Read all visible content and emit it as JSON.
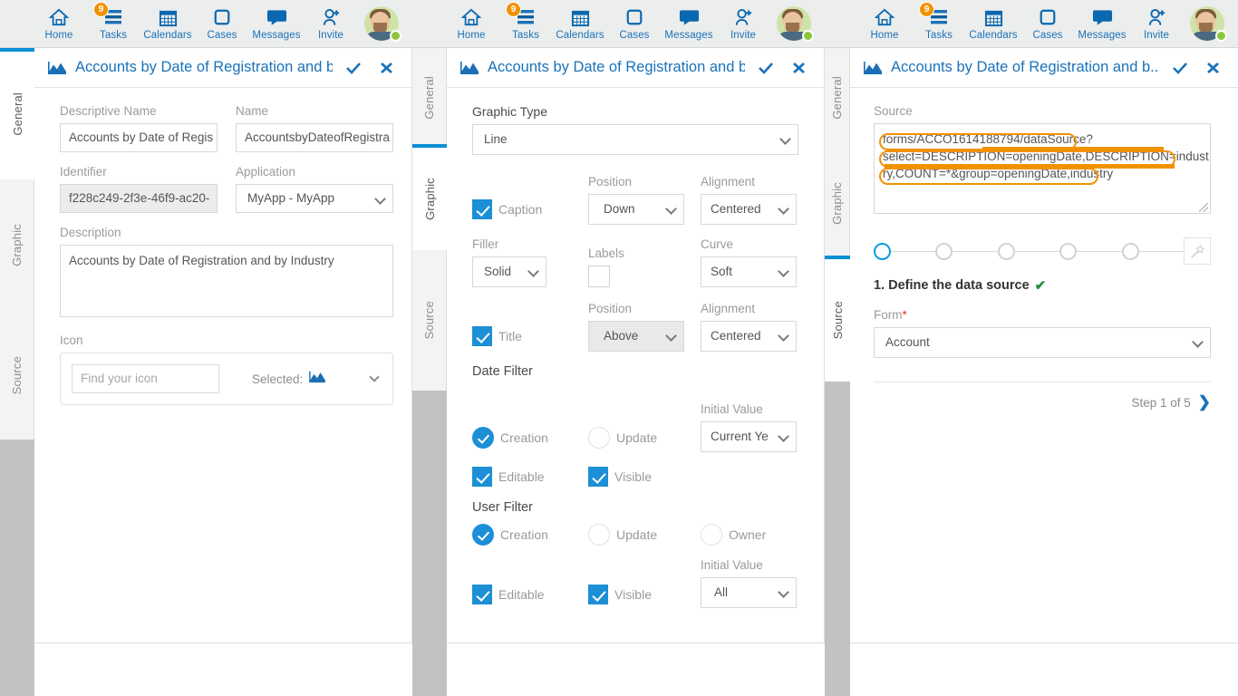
{
  "nav": {
    "items": [
      {
        "label": "Home",
        "icon": "home-icon",
        "badge": null
      },
      {
        "label": "Tasks",
        "icon": "tasks-icon",
        "badge": "9"
      },
      {
        "label": "Calendars",
        "icon": "calendar-icon",
        "badge": null
      },
      {
        "label": "Cases",
        "icon": "cases-icon",
        "badge": null
      },
      {
        "label": "Messages",
        "icon": "messages-icon",
        "badge": null
      },
      {
        "label": "Invite",
        "icon": "invite-user-icon",
        "badge": null
      }
    ]
  },
  "window": {
    "title": "Accounts by Date of Registration and b...",
    "accept_label": "✔",
    "close_label": "✖"
  },
  "vtabs": [
    "General",
    "Graphic",
    "Source"
  ],
  "panel1": {
    "active_tab": "General",
    "descriptive_name": {
      "label": "Descriptive Name",
      "value": "Accounts by Date of Regis"
    },
    "name": {
      "label": "Name",
      "value": "AccountsbyDateofRegistra"
    },
    "identifier": {
      "label": "Identifier",
      "value": "f228c249-2f3e-46f9-ac20-"
    },
    "application": {
      "label": "Application",
      "value": "MyApp - MyApp"
    },
    "description": {
      "label": "Description",
      "value": "Accounts by Date of Registration and by Industry"
    },
    "icon": {
      "label": "Icon",
      "search_placeholder": "Find your icon",
      "selected_label": "Selected:",
      "selected_icon": "chart-area-icon"
    }
  },
  "panel2": {
    "active_tab": "Graphic",
    "graphic_type": {
      "label": "Graphic Type",
      "value": "Line"
    },
    "caption": {
      "checkbox_label": "Caption",
      "checked": true,
      "position_label": "Position",
      "position_value": "Down",
      "alignment_label": "Alignment",
      "alignment_value": "Centered"
    },
    "filler": {
      "label": "Filler",
      "value": "Solid"
    },
    "labels": {
      "label": "Labels",
      "checked": false
    },
    "curve": {
      "label": "Curve",
      "value": "Soft"
    },
    "title": {
      "checkbox_label": "Title",
      "checked": true,
      "position_label": "Position",
      "position_value": "Above",
      "alignment_label": "Alignment",
      "alignment_value": "Centered"
    },
    "date_filter": {
      "heading": "Date Filter",
      "creation_label": "Creation",
      "creation_on": true,
      "update_label": "Update",
      "update_on": false,
      "initial_value_label": "Initial Value",
      "initial_value": "Current Ye",
      "editable_label": "Editable",
      "editable_on": true,
      "visible_label": "Visible",
      "visible_on": true
    },
    "user_filter": {
      "heading": "User Filter",
      "creation_label": "Creation",
      "creation_on": true,
      "update_label": "Update",
      "update_on": false,
      "owner_label": "Owner",
      "owner_on": false,
      "initial_value_label": "Initial Value",
      "initial_value": "All",
      "editable_label": "Editable",
      "editable_on": true,
      "visible_label": "Visible",
      "visible_on": true
    }
  },
  "panel3": {
    "active_tab": "Source",
    "source": {
      "label": "Source",
      "value": "forms/ACCO1614188794/dataSource?select=DESCRIPTION=openingDate,DESCRIPTION=industry,COUNT=*&group=openingDate,industry",
      "line1": "forms/ACCO1614188794/dataSource?",
      "line2": "select=DESCRIPTION=openingDate,DESCRIPTION=indust",
      "line3": "ry,COUNT=*&group=openingDate,industry",
      "highlight_color": "#f29100"
    },
    "stepper": {
      "total": 5,
      "current": 1,
      "wand_icon": "magic-wand-icon"
    },
    "step_title": "1. Define the data source",
    "step_title_check": "✔",
    "form": {
      "label": "Form",
      "required_mark": "*",
      "value": "Account"
    },
    "step_nav": {
      "text": "Step 1 of 5",
      "next_icon": "chevron-right-icon"
    }
  },
  "colors": {
    "accent": "#1a72b8",
    "active_tab_bar": "#0b8ed6",
    "checkbox_on": "#1c8fd6",
    "badge": "#f29100",
    "highlight": "#f29100",
    "ok_green": "#1e8e3e"
  }
}
